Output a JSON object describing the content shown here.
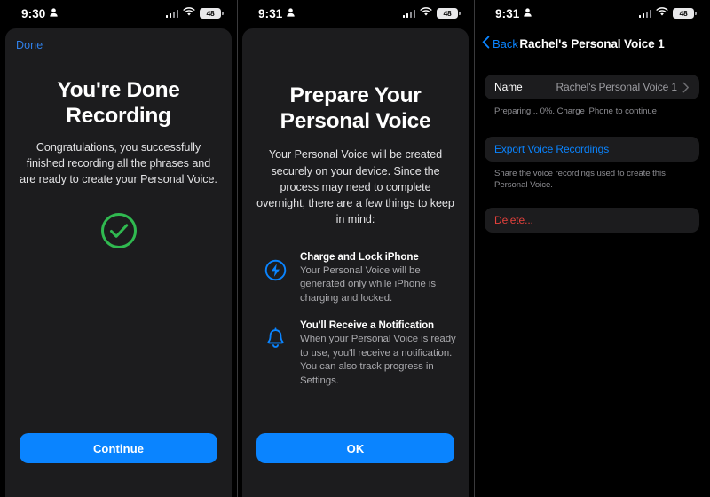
{
  "panels": {
    "done_recording": {
      "status_bar": {
        "time": "9:30",
        "battery": "48",
        "person_icon": "person-icon",
        "wifi_icon": "wifi-icon",
        "cellular_icon": "cellular-signal-icon"
      },
      "done_label": "Done",
      "title": "You're Done Recording",
      "subtitle": "Congratulations, you successfully finished recording all the phrases and are ready to create your Personal Voice.",
      "success_icon": "check-circle-icon",
      "cta_label": "Continue"
    },
    "prepare": {
      "status_bar": {
        "time": "9:31",
        "battery": "48",
        "person_icon": "person-icon",
        "wifi_icon": "wifi-icon",
        "cellular_icon": "cellular-signal-icon"
      },
      "title": "Prepare Your Personal Voice",
      "paragraph": "Your Personal Voice will be created securely on your device. Since the process may need to complete overnight, there are a few things to keep in mind:",
      "bullets": [
        {
          "icon": "bolt-circle-icon",
          "heading": "Charge and Lock iPhone",
          "description": "Your Personal Voice will be generated only while iPhone is charging and locked."
        },
        {
          "icon": "bell-icon",
          "heading": "You'll Receive a Notification",
          "description": "When your Personal Voice is ready to use, you'll receive a notification. You can also track progress in Settings."
        }
      ],
      "cta_label": "OK"
    },
    "detail": {
      "status_bar": {
        "time": "9:31",
        "battery": "48",
        "person_icon": "person-icon",
        "wifi_icon": "wifi-icon",
        "cellular_icon": "cellular-signal-icon"
      },
      "back_label": "Back",
      "back_icon": "chevron-left-icon",
      "nav_title": "Rachel's Personal Voice 1",
      "name_row": {
        "label": "Name",
        "value": "Rachel's Personal Voice 1",
        "chevron_icon": "chevron-right-icon"
      },
      "status_footnote": "Preparing... 0%. Charge iPhone to continue",
      "export_label": "Export Voice Recordings",
      "export_footnote": "Share the voice recordings used to create this Personal Voice.",
      "delete_label": "Delete..."
    }
  },
  "colors": {
    "accent_blue": "#0a84ff",
    "success_green": "#30b950",
    "destructive_red": "#e5413c",
    "sheet_background": "#1c1c1e",
    "page_background": "#000000"
  }
}
